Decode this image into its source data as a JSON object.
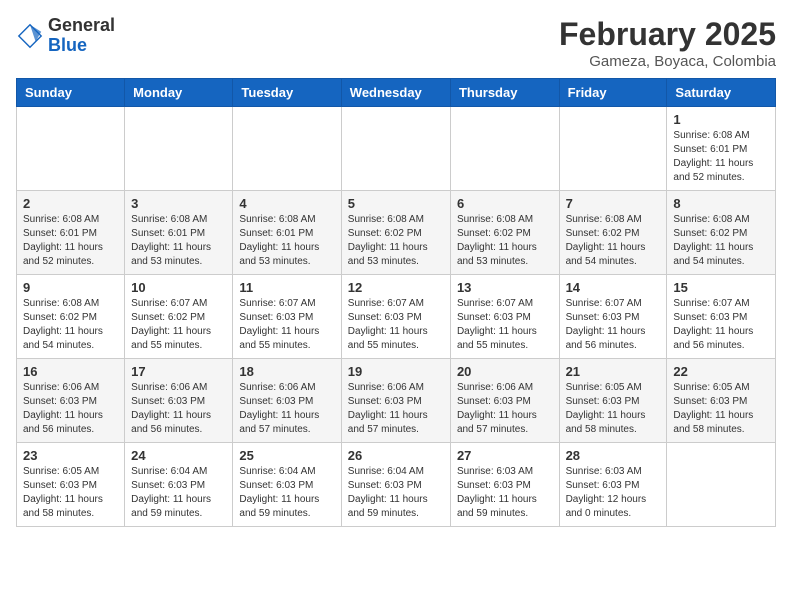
{
  "header": {
    "logo_general": "General",
    "logo_blue": "Blue",
    "month_year": "February 2025",
    "location": "Gameza, Boyaca, Colombia"
  },
  "weekdays": [
    "Sunday",
    "Monday",
    "Tuesday",
    "Wednesday",
    "Thursday",
    "Friday",
    "Saturday"
  ],
  "weeks": [
    [
      {
        "day": "",
        "info": ""
      },
      {
        "day": "",
        "info": ""
      },
      {
        "day": "",
        "info": ""
      },
      {
        "day": "",
        "info": ""
      },
      {
        "day": "",
        "info": ""
      },
      {
        "day": "",
        "info": ""
      },
      {
        "day": "1",
        "info": "Sunrise: 6:08 AM\nSunset: 6:01 PM\nDaylight: 11 hours\nand 52 minutes."
      }
    ],
    [
      {
        "day": "2",
        "info": "Sunrise: 6:08 AM\nSunset: 6:01 PM\nDaylight: 11 hours\nand 52 minutes."
      },
      {
        "day": "3",
        "info": "Sunrise: 6:08 AM\nSunset: 6:01 PM\nDaylight: 11 hours\nand 53 minutes."
      },
      {
        "day": "4",
        "info": "Sunrise: 6:08 AM\nSunset: 6:01 PM\nDaylight: 11 hours\nand 53 minutes."
      },
      {
        "day": "5",
        "info": "Sunrise: 6:08 AM\nSunset: 6:02 PM\nDaylight: 11 hours\nand 53 minutes."
      },
      {
        "day": "6",
        "info": "Sunrise: 6:08 AM\nSunset: 6:02 PM\nDaylight: 11 hours\nand 53 minutes."
      },
      {
        "day": "7",
        "info": "Sunrise: 6:08 AM\nSunset: 6:02 PM\nDaylight: 11 hours\nand 54 minutes."
      },
      {
        "day": "8",
        "info": "Sunrise: 6:08 AM\nSunset: 6:02 PM\nDaylight: 11 hours\nand 54 minutes."
      }
    ],
    [
      {
        "day": "9",
        "info": "Sunrise: 6:08 AM\nSunset: 6:02 PM\nDaylight: 11 hours\nand 54 minutes."
      },
      {
        "day": "10",
        "info": "Sunrise: 6:07 AM\nSunset: 6:02 PM\nDaylight: 11 hours\nand 55 minutes."
      },
      {
        "day": "11",
        "info": "Sunrise: 6:07 AM\nSunset: 6:03 PM\nDaylight: 11 hours\nand 55 minutes."
      },
      {
        "day": "12",
        "info": "Sunrise: 6:07 AM\nSunset: 6:03 PM\nDaylight: 11 hours\nand 55 minutes."
      },
      {
        "day": "13",
        "info": "Sunrise: 6:07 AM\nSunset: 6:03 PM\nDaylight: 11 hours\nand 55 minutes."
      },
      {
        "day": "14",
        "info": "Sunrise: 6:07 AM\nSunset: 6:03 PM\nDaylight: 11 hours\nand 56 minutes."
      },
      {
        "day": "15",
        "info": "Sunrise: 6:07 AM\nSunset: 6:03 PM\nDaylight: 11 hours\nand 56 minutes."
      }
    ],
    [
      {
        "day": "16",
        "info": "Sunrise: 6:06 AM\nSunset: 6:03 PM\nDaylight: 11 hours\nand 56 minutes."
      },
      {
        "day": "17",
        "info": "Sunrise: 6:06 AM\nSunset: 6:03 PM\nDaylight: 11 hours\nand 56 minutes."
      },
      {
        "day": "18",
        "info": "Sunrise: 6:06 AM\nSunset: 6:03 PM\nDaylight: 11 hours\nand 57 minutes."
      },
      {
        "day": "19",
        "info": "Sunrise: 6:06 AM\nSunset: 6:03 PM\nDaylight: 11 hours\nand 57 minutes."
      },
      {
        "day": "20",
        "info": "Sunrise: 6:06 AM\nSunset: 6:03 PM\nDaylight: 11 hours\nand 57 minutes."
      },
      {
        "day": "21",
        "info": "Sunrise: 6:05 AM\nSunset: 6:03 PM\nDaylight: 11 hours\nand 58 minutes."
      },
      {
        "day": "22",
        "info": "Sunrise: 6:05 AM\nSunset: 6:03 PM\nDaylight: 11 hours\nand 58 minutes."
      }
    ],
    [
      {
        "day": "23",
        "info": "Sunrise: 6:05 AM\nSunset: 6:03 PM\nDaylight: 11 hours\nand 58 minutes."
      },
      {
        "day": "24",
        "info": "Sunrise: 6:04 AM\nSunset: 6:03 PM\nDaylight: 11 hours\nand 59 minutes."
      },
      {
        "day": "25",
        "info": "Sunrise: 6:04 AM\nSunset: 6:03 PM\nDaylight: 11 hours\nand 59 minutes."
      },
      {
        "day": "26",
        "info": "Sunrise: 6:04 AM\nSunset: 6:03 PM\nDaylight: 11 hours\nand 59 minutes."
      },
      {
        "day": "27",
        "info": "Sunrise: 6:03 AM\nSunset: 6:03 PM\nDaylight: 11 hours\nand 59 minutes."
      },
      {
        "day": "28",
        "info": "Sunrise: 6:03 AM\nSunset: 6:03 PM\nDaylight: 12 hours\nand 0 minutes."
      },
      {
        "day": "",
        "info": ""
      }
    ]
  ]
}
